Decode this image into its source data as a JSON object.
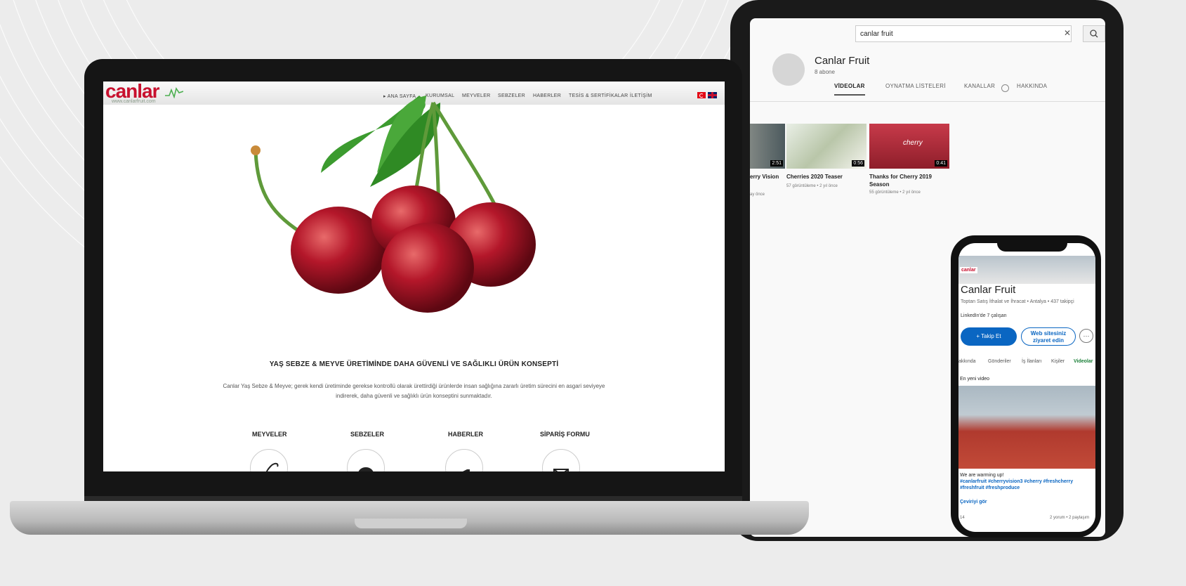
{
  "laptop": {
    "logo": "canlar",
    "url": "www.canlarfruit.com",
    "nav": [
      "▸ ANA SAYFA",
      "KURUMSAL",
      "MEYVELER",
      "SEBZELER",
      "HABERLER",
      "TESİS & SERTİFİKALAR",
      "İLETİŞİM"
    ],
    "headline": "YAŞ SEBZE & MEYVE ÜRETİMİNDE DAHA GÜVENLİ VE SAĞLIKLI ÜRÜN KONSEPTİ",
    "description": "Canlar Yaş Sebze & Meyve; gerek kendi üretiminde gerekse kontrollü olarak ürettirdiği ürünlerde insan sağlığına zararlı üretim sürecini en asgari seviyeye indirerek, daha güvenli ve sağlıklı ürün konseptini sunmaktadır.",
    "categories": [
      "MEYVELER",
      "SEBZELER",
      "HABERLER",
      "SİPARİŞ FORMU"
    ],
    "brand_color": "#c8102e"
  },
  "tablet": {
    "search_query": "canlar fruit",
    "channel_name": "Canlar Fruit",
    "subscribers": "8 abone",
    "tabs": [
      "VİDEOLAR",
      "OYNATMA LİSTELERİ",
      "KANALLAR",
      "HAKKINDA"
    ],
    "videos": [
      {
        "title": "erry Vision",
        "meta": "ay önce",
        "duration": "2:51"
      },
      {
        "title": "Cherries 2020 Teaser",
        "meta": "57 görüntüleme • 2 yıl önce",
        "duration": "0:56"
      },
      {
        "title": "Thanks for Cherry 2019 Season",
        "meta": "55 görüntüleme • 2 yıl önce",
        "duration": "0:41",
        "overlay": "cherry"
      }
    ]
  },
  "phone": {
    "logo": "canlar",
    "name": "Canlar Fruit",
    "subtitle": "Toptan Satış İthalat ve İhracat • Antalya • 437 takipçi",
    "linkedin": "LinkedIn'de 7 çalışan",
    "follow_label": "+ Takip Et",
    "web_label": "Web sitesiniz ziyaret edin",
    "more_label": "···",
    "tabs": [
      "akkında",
      "Gönderiler",
      "İş İlanları",
      "Kişiler",
      "Videolar"
    ],
    "section": "En yeni video",
    "post_text": "We are warming up!",
    "post_tags": "#canlarfruit #cherryvision3 #cherry #freshcherry #freshfruit #freshproduce",
    "translate": "Çeviriyi gör",
    "reactions": "14",
    "comments": "2 yorum • 2 paylaşım"
  }
}
